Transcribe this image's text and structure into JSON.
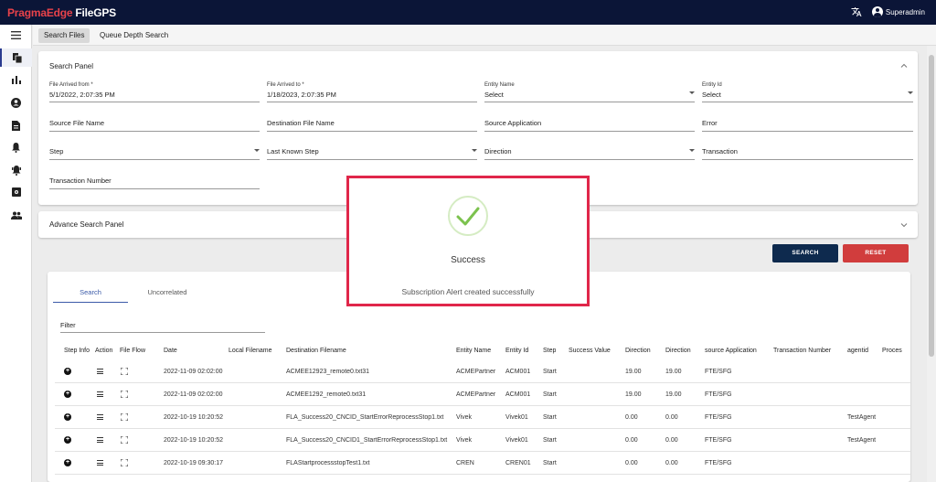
{
  "app": {
    "brand_part1": "PragmaEdge",
    "brand_part2": "FileGPS"
  },
  "user": {
    "name": "Superadmin"
  },
  "tabs": [
    {
      "label": "Search Files"
    },
    {
      "label": "Queue Depth Search"
    }
  ],
  "search_panel": {
    "title": "Search Panel",
    "file_arrived_from": {
      "label": "File Arrived from *",
      "value": "5/1/2022, 2:07:35 PM"
    },
    "file_arrived_to": {
      "label": "File Arrived to *",
      "value": "1/18/2023, 2:07:35 PM"
    },
    "entity_name": {
      "label": "Entity Name",
      "value": "Select"
    },
    "entity_id": {
      "label": "Entity Id",
      "value": "Select"
    },
    "source_file_name": "Source File Name",
    "destination_file_name": "Destination File Name",
    "source_application": "Source Application",
    "error": "Error",
    "step": "Step",
    "last_known_step": "Last Known Step",
    "direction": "Direction",
    "transaction": "Transaction",
    "transaction_number": "Transaction Number"
  },
  "advance_panel": {
    "title": "Advance Search Panel"
  },
  "buttons": {
    "search": "SEARCH",
    "reset": "RESET"
  },
  "results": {
    "tabs": [
      {
        "label": "Search"
      },
      {
        "label": "Uncorrelated"
      }
    ],
    "filter_label": "Filter",
    "columns": [
      "Step Info",
      "Action",
      "File Flow",
      "Date",
      "Local Filename",
      "Destination Filename",
      "Entity Name",
      "Entity Id",
      "Step",
      "Success Value",
      "Direction",
      "Direction",
      "source Application",
      "Transaction Number",
      "agentid",
      "Proces"
    ],
    "rows": [
      {
        "date": "2022-11-09 02:02:00",
        "dest": "ACMEE12923_remote0.txt31",
        "entity_name": "ACMEPartner",
        "entity_id": "ACM001",
        "step": "Start",
        "dir1": "19.00",
        "dir2": "19.00",
        "src_app": "FTE/SFG",
        "agent": ""
      },
      {
        "date": "2022-11-09 02:02:00",
        "dest": "ACMEE1292_remote0.txt31",
        "entity_name": "ACMEPartner",
        "entity_id": "ACM001",
        "step": "Start",
        "dir1": "19.00",
        "dir2": "19.00",
        "src_app": "FTE/SFG",
        "agent": ""
      },
      {
        "date": "2022-10-19 10:20:52",
        "dest": "FLA_Success20_CNCID_StartErrorReprocessStop1.txt",
        "entity_name": "Vivek",
        "entity_id": "Vivek01",
        "step": "Start",
        "dir1": "0.00",
        "dir2": "0.00",
        "src_app": "FTE/SFG",
        "agent": "TestAgent"
      },
      {
        "date": "2022-10-19 10:20:52",
        "dest": "FLA_Success20_CNCID1_StartErrorReprocessStop1.txt",
        "entity_name": "Vivek",
        "entity_id": "Vivek01",
        "step": "Start",
        "dir1": "0.00",
        "dir2": "0.00",
        "src_app": "FTE/SFG",
        "agent": "TestAgent"
      },
      {
        "date": "2022-10-19 09:30:17",
        "dest": "FLAStartprocessstopTest1.txt",
        "entity_name": "CREN",
        "entity_id": "CREN01",
        "step": "Start",
        "dir1": "0.00",
        "dir2": "0.00",
        "src_app": "FTE/SFG",
        "agent": ""
      }
    ]
  },
  "dialog": {
    "title": "Success",
    "message": "Subscription Alert created successfully"
  },
  "colors": {
    "topbar": "#0b1537",
    "brand_red": "#e8424a",
    "primary": "#0e2a4e",
    "danger": "#d13d3d",
    "highlight": "#e0274a",
    "success": "#5cb85c"
  }
}
